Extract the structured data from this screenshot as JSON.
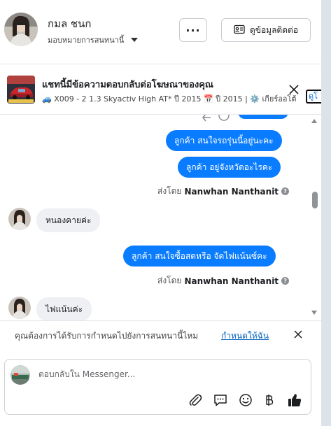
{
  "header": {
    "name": "กมล ชนก",
    "assign_label": "มอบหมายการสนทนานี้",
    "more_label": "···",
    "contact_button": "ดูข้อมูลติดต่อ"
  },
  "ad_banner": {
    "title": "แชทนี้มีข้อความตอบกลับต่อโฆษณาของคุณ",
    "subtitle": "🚙 X009 - 2 1.3 Skyactiv High AT* ปี 2015 📅 ปี 2015 | ⚙️ เกียร์ออโต้",
    "link_label": "ดูโ"
  },
  "messages": [
    {
      "type": "outgoing",
      "text": "ลูกค้า สนใจรถรุ่นนี้อยู่นะคะ"
    },
    {
      "type": "outgoing",
      "text": "ลูกค้า อยู่จังหวัดอะไรคะ"
    },
    {
      "type": "sent_by",
      "prefix": "ส่งโดย",
      "sender": "Nanwhan Nanthanit"
    },
    {
      "type": "incoming",
      "text": "หนองคายค่ะ"
    },
    {
      "type": "outgoing",
      "text": "ลูกค้า สนใจซื้อสดหรือ จัดไฟแน้นซ์คะ"
    },
    {
      "type": "sent_by",
      "prefix": "ส่งโดย",
      "sender": "Nanwhan Nanthanit"
    },
    {
      "type": "incoming",
      "text": "ไฟแน้นค่ะ"
    }
  ],
  "suggestion": {
    "text": "คุณต้องการได้รับการกำหนดไปยังการสนทนานี้ไหม",
    "link": "กำหนดให้ฉัน"
  },
  "composer": {
    "placeholder": "ตอบกลับใน Messenger..."
  },
  "colors": {
    "accent": "#0a7cff",
    "incoming_bubble": "#eef0f3",
    "link": "#0a66c2"
  }
}
